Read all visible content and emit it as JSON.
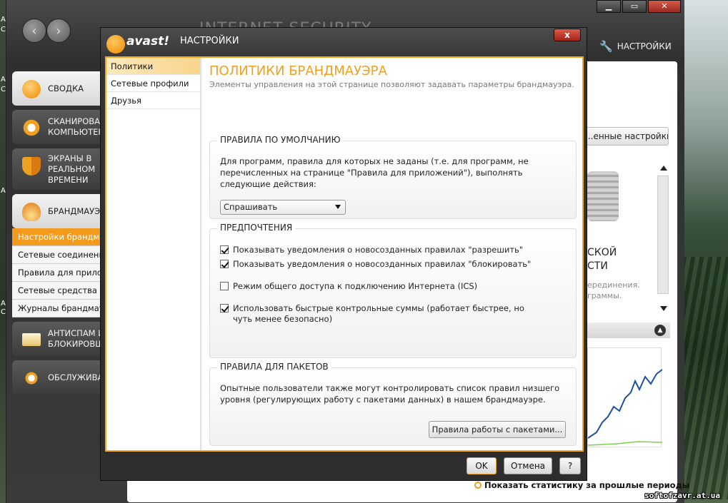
{
  "window": {
    "brand": "INTERNET SECURITY",
    "settings_label": "НАСТРОЙКИ"
  },
  "left_nav": {
    "summary": "СВОДКА",
    "scan": "СКАНИРОВАТЬ КОМПЬЮТЕР",
    "shields": "ЭКРАНЫ В РЕАЛЬНОМ ВРЕМЕНИ",
    "firewall": "БРАНДМАУЭР",
    "firewall_sub": [
      "Настройки брандмауэра",
      "Сетевые соединения",
      "Правила для приложений",
      "Сетевые средства",
      "Журналы брандмауэра"
    ],
    "antispam": "АНТИСПАМ И БЛОКИРОВЩИК",
    "maintenance": "ОБСЛУЖИВАНИЕ"
  },
  "background": {
    "settings_button": "...енные настройки",
    "fragment_1": "СКОЙ\nСТИ",
    "fragment_2": "ерединения.\nграммы.",
    "stat_label": "Показать статистику за прошлые периоды"
  },
  "dialog": {
    "logo_word": "avast!",
    "title": "НАСТРОЙКИ",
    "close": "x",
    "sidebar": [
      "Политики",
      "Сетевые профили",
      "Друзья"
    ],
    "heading": "ПОЛИТИКИ БРАНДМАУЭРА",
    "subheading": "Элементы управления на этой странице позволяют задавать параметры брандмауэра.",
    "default_rules": {
      "title": "ПРАВИЛА ПО УМОЛЧАНИЮ",
      "text": "Для программ, правила для которых не заданы (т.е. для программ, не перечисленных на странице \"Правила для приложений\"), выполнять следующие действия:",
      "select_value": "Спрашивать"
    },
    "preferences": {
      "title": "ПРЕДПОЧТЕНИЯ",
      "items": [
        {
          "label": "Показывать уведомления о новосозданных правилах \"разрешить\"",
          "checked": true
        },
        {
          "label": "Показывать уведомления о новосозданных правилах \"блокировать\"",
          "checked": true
        },
        {
          "label": "Режим общего доступа к подключению Интернета (ICS)",
          "checked": false
        },
        {
          "label": "Использовать быстрые контрольные суммы (работает быстрее, но чуть менее безопасно)",
          "checked": true
        }
      ]
    },
    "packet_rules": {
      "title": "ПРАВИЛА ДЛЯ ПАКЕТОВ",
      "text": "Опытные пользователи также могут контролировать список правил низшего уровня (регулирующих работу с пакетами данных) в нашем брандмауэре.",
      "button": "Правила работы с пакетами..."
    },
    "buttons": {
      "ok": "OK",
      "cancel": "Отмена",
      "help": "?"
    }
  },
  "watermark": "softofzavr.at.ua",
  "desktop_chars": [
    "A",
    "C",
    "A",
    "C",
    "A",
    "A",
    "C"
  ]
}
